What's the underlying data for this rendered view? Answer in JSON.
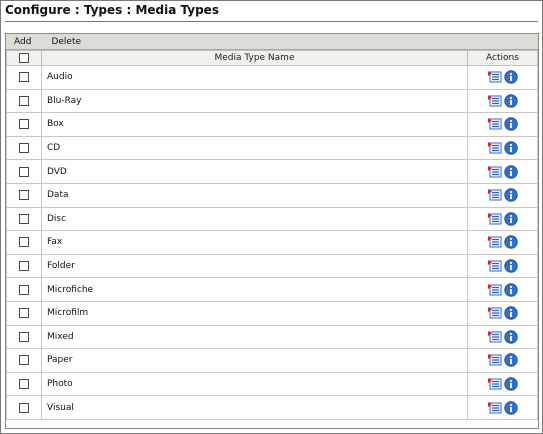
{
  "header": {
    "title": "Configure : Types : Media Types"
  },
  "toolbar": {
    "add_label": "Add",
    "delete_label": "Delete"
  },
  "table": {
    "columns": {
      "name": "Media Type Name",
      "actions": "Actions"
    },
    "rows": [
      {
        "name": "Audio"
      },
      {
        "name": "Blu-Ray"
      },
      {
        "name": "Box"
      },
      {
        "name": "CD"
      },
      {
        "name": "DVD"
      },
      {
        "name": "Data"
      },
      {
        "name": "Disc"
      },
      {
        "name": "Fax"
      },
      {
        "name": "Folder"
      },
      {
        "name": "Microfiche"
      },
      {
        "name": "Microfilm"
      },
      {
        "name": "Mixed"
      },
      {
        "name": "Paper"
      },
      {
        "name": "Photo"
      },
      {
        "name": "Visual"
      }
    ]
  },
  "icons": {
    "edit": "edit-list-icon",
    "info": "info-icon"
  },
  "colors": {
    "toolbar": "#dcdcd5",
    "info_blue": "#2f6fd0",
    "edit_red": "#d8232a",
    "edit_blue": "#2c63c9"
  }
}
